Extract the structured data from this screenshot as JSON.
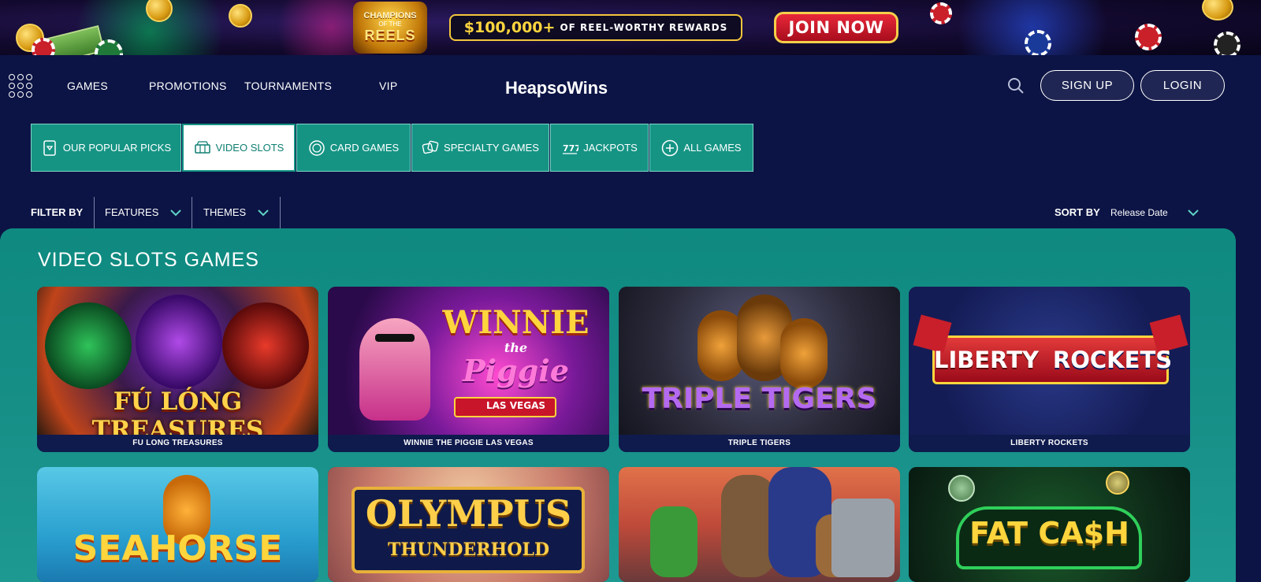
{
  "banner": {
    "logo_line1": "CHAMPIONS",
    "logo_line2": "OF THE",
    "logo_line3": "REELS",
    "reward_amount": "$100,000+",
    "reward_text": "OF REEL-WORTHY REWARDS",
    "join_label": "JOIN NOW"
  },
  "nav": {
    "menu_icon": "grid-menu-icon",
    "items": [
      {
        "label": "GAMES"
      },
      {
        "label": "PROMOTIONS"
      },
      {
        "label": "TOURNAMENTS"
      },
      {
        "label": "VIP"
      }
    ],
    "logo_part1": "Heaps",
    "logo_part2": "o",
    "logo_part3": "Wins",
    "search_icon": "search-icon",
    "signup_label": "SIGN UP",
    "login_label": "LOGIN"
  },
  "categories": [
    {
      "label": "OUR POPULAR PICKS",
      "icon": "popular-picks-icon",
      "active": false
    },
    {
      "label": "VIDEO SLOTS",
      "icon": "slot-machine-icon",
      "active": true
    },
    {
      "label": "CARD GAMES",
      "icon": "poker-chip-icon",
      "active": false
    },
    {
      "label": "SPECIALTY GAMES",
      "icon": "dice-icon",
      "active": false
    },
    {
      "label": "JACKPOTS",
      "icon": "jackpot-icon",
      "active": false
    },
    {
      "label": "ALL GAMES",
      "icon": "plus-circle-icon",
      "active": false
    }
  ],
  "filters": {
    "filter_by_label": "FILTER BY",
    "features_label": "FEATURES",
    "themes_label": "THEMES",
    "sort_by_label": "SORT BY",
    "sort_value": "Release Date"
  },
  "section": {
    "title": "VIDEO SLOTS GAMES"
  },
  "games": [
    {
      "caption": "FU LONG TREASURES",
      "art_title": "FÚ LÓNG TREASURES"
    },
    {
      "caption": "WINNIE THE PIGGIE LAS VEGAS",
      "art_title1": "WINNIE",
      "art_title2": "the",
      "art_title3": "Piggie",
      "art_title4": "LAS VEGAS"
    },
    {
      "caption": "TRIPLE TIGERS",
      "art_title": "TRIPLE TIGERS"
    },
    {
      "caption": "LIBERTY ROCKETS",
      "art_title1": "LIBERTY",
      "art_title2": "ROCKETS"
    },
    {
      "art_title": "SEAHORSE"
    },
    {
      "art_title1": "OLYMPUS",
      "art_title2": "THUNDERHOLD"
    },
    {
      "art_title": ""
    },
    {
      "art_title": "FAT CA$H"
    }
  ],
  "colors": {
    "page_bg": "#0c1445",
    "accent_teal": "#159484",
    "panel_teal": "#168f87",
    "gold": "#f3c63b",
    "join_red": "#d01f2f"
  }
}
